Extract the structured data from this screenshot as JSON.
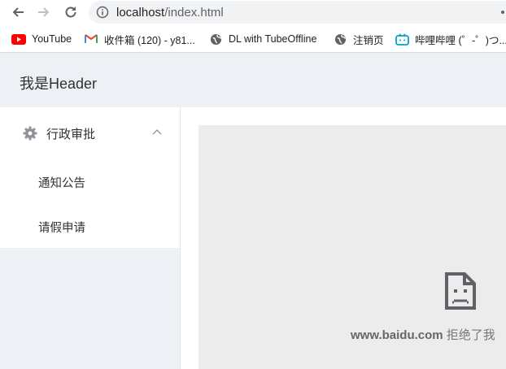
{
  "browser": {
    "url_host": "localhost",
    "url_path": "/index.html",
    "bookmarks": [
      {
        "label": "YouTube",
        "icon": "youtube-icon"
      },
      {
        "label": "收件箱 (120) - y81...",
        "icon": "gmail-icon"
      },
      {
        "label": "DL with TubeOffline",
        "icon": "globe-icon"
      },
      {
        "label": "注销页",
        "icon": "globe-icon"
      },
      {
        "label": "哔哩哔哩 (゜-゜)つ...",
        "icon": "bilibili-icon"
      }
    ]
  },
  "header": {
    "title": "我是Header"
  },
  "sidebar": {
    "group_label": "行政审批",
    "group_icon": "gear-icon",
    "items": [
      {
        "label": "通知公告"
      },
      {
        "label": "请假申请"
      }
    ]
  },
  "iframe_error": {
    "host": "www.baidu.com",
    "message": " 拒绝了我"
  },
  "colors": {
    "header_bg": "#edf0f4",
    "sidebar_bg": "#eef1f5",
    "frame_bg": "#ececec"
  }
}
